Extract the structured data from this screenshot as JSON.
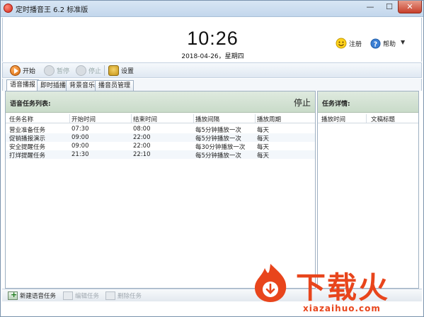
{
  "window": {
    "title": "定时播音王 6.2 标准版",
    "min_glyph": "—",
    "max_glyph": "☐",
    "close_glyph": "✕"
  },
  "header": {
    "clock": "10:26",
    "date": "2018-04-26，星期四",
    "register_label": "注册",
    "help_label": "帮助",
    "menu_arrow": "▼"
  },
  "toolbar": {
    "start_label": "开始",
    "pause_label": "暂停",
    "stop_label": "停止",
    "settings_label": "设置"
  },
  "tabs": [
    {
      "label": "语音播报",
      "active": true
    },
    {
      "label": "即时插播",
      "active": false
    },
    {
      "label": "背景音乐",
      "active": false
    },
    {
      "label": "播音员管理",
      "active": false
    }
  ],
  "task_list": {
    "title": "语音任务列表:",
    "status": "停止",
    "columns": [
      "任务名称",
      "开始时间",
      "结束时间",
      "播放间隔",
      "播放周期"
    ],
    "rows": [
      [
        "营业准备任务",
        "07:30",
        "08:00",
        "每5分钟播放一次",
        "每天"
      ],
      [
        "促销播报演示",
        "09:00",
        "22:00",
        "每5分钟播放一次",
        "每天"
      ],
      [
        "安全提醒任务",
        "09:00",
        "22:00",
        "每30分钟播放一次",
        "每天"
      ],
      [
        "打烊提醒任务",
        "21:30",
        "22:10",
        "每5分钟播放一次",
        "每天"
      ]
    ]
  },
  "task_detail": {
    "title": "任务详情:",
    "columns": [
      "播放时间",
      "文稿标题"
    ]
  },
  "bottom_bar": {
    "new_label": "新建语音任务",
    "edit_label": "编辑任务",
    "delete_label": "删除任务"
  },
  "watermark": {
    "brand": "下载火",
    "domain": "xiazaihuo.com"
  },
  "colors": {
    "accent": "#e8451c",
    "panel_head": "#c9dbc9"
  }
}
